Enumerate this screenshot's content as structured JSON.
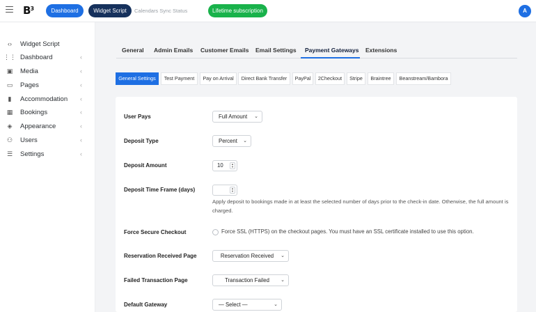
{
  "topbar": {
    "logo": "B",
    "dashboard_label": "Dashboard",
    "widget_label": "Widget Script",
    "calendars_status": "Calendars Sync Status",
    "lifetime_label": "Lifetime subscription",
    "avatar_letter": "A"
  },
  "sidebar": {
    "items": [
      {
        "label": "Widget Script",
        "icon": "code-icon",
        "glyph": "‹›",
        "chevron": ""
      },
      {
        "label": "Dashboard",
        "icon": "grid-icon",
        "glyph": "⋮⋮",
        "chevron": "‹"
      },
      {
        "label": "Media",
        "icon": "image-icon",
        "glyph": "▣",
        "chevron": "‹"
      },
      {
        "label": "Pages",
        "icon": "folder-icon",
        "glyph": "▭",
        "chevron": "‹"
      },
      {
        "label": "Accommodation",
        "icon": "door-icon",
        "glyph": "▮",
        "chevron": "‹"
      },
      {
        "label": "Bookings",
        "icon": "calendar-icon",
        "glyph": "▦",
        "chevron": "‹"
      },
      {
        "label": "Appearance",
        "icon": "paint-bucket-icon",
        "glyph": "◈",
        "chevron": "‹"
      },
      {
        "label": "Users",
        "icon": "users-icon",
        "glyph": "⚇",
        "chevron": "‹"
      },
      {
        "label": "Settings",
        "icon": "sliders-icon",
        "glyph": "☰",
        "chevron": "‹"
      }
    ]
  },
  "main_tabs": [
    "General",
    "Admin Emails",
    "Customer Emails",
    "Email Settings",
    "Payment Gateways",
    "Extensions"
  ],
  "sub_tabs": [
    "General Settings",
    "Test Payment",
    "Pay on Arrival",
    "Direct Bank Transfer",
    "PayPal",
    "2Checkout",
    "Stripe",
    "Braintree",
    "Beanstream/Bambora"
  ],
  "settings": {
    "user_pays": {
      "label": "User Pays",
      "value": "Full Amount"
    },
    "deposit_type": {
      "label": "Deposit Type",
      "value": "Percent"
    },
    "deposit_amount": {
      "label": "Deposit Amount",
      "value": "10"
    },
    "deposit_time_frame": {
      "label": "Deposit Time Frame (days)",
      "value": "",
      "help": "Apply deposit to bookings made in at least the selected number of days prior to the check-in date. Otherwise, the full amount is charged."
    },
    "force_secure": {
      "label": "Force Secure Checkout",
      "text": "Force SSL (HTTPS) on the checkout pages. You must have an SSL certificate installed to use this option."
    },
    "reservation_page": {
      "label": "Reservation Received Page",
      "value": "Reservation Received"
    },
    "failed_page": {
      "label": "Failed Transaction Page",
      "value": "Transaction Failed"
    },
    "default_gateway": {
      "label": "Default Gateway",
      "value": "— Select —"
    }
  },
  "colors": {
    "accent": "#1e6fe3",
    "navy": "#16315c",
    "success": "#19b24b"
  }
}
